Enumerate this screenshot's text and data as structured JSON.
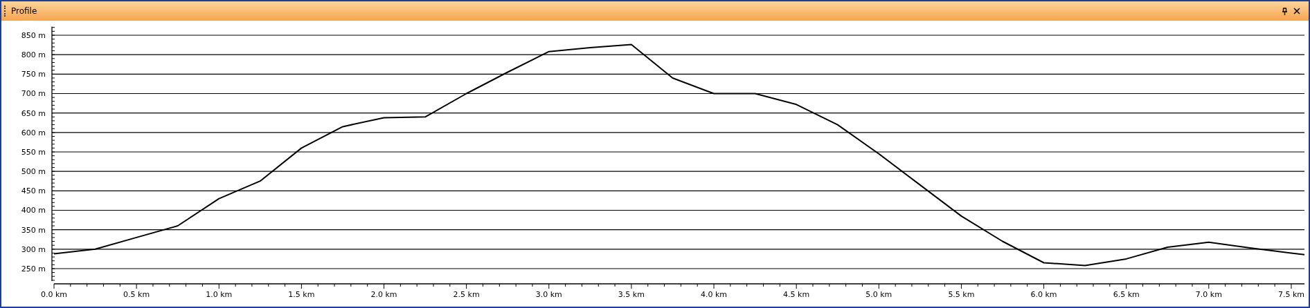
{
  "window": {
    "title": "Profile",
    "pinned": true,
    "closable": true
  },
  "chart_data": {
    "type": "line",
    "grid": true,
    "xlim": [
      0,
      7.58
    ],
    "ylim": [
      218,
      872
    ],
    "x": [
      0,
      0.25,
      0.5,
      0.75,
      1.0,
      1.25,
      1.5,
      1.75,
      2.0,
      2.25,
      2.5,
      2.75,
      3.0,
      3.25,
      3.5,
      3.75,
      4.0,
      4.25,
      4.5,
      4.75,
      5.0,
      5.25,
      5.5,
      5.75,
      6.0,
      6.25,
      6.5,
      6.75,
      7.0,
      7.25,
      7.5,
      7.58
    ],
    "series": [
      {
        "color": "#000000",
        "values": [
          288,
          300,
          330,
          360,
          430,
          475,
          560,
          615,
          638,
          640,
          700,
          755,
          808,
          818,
          826,
          740,
          700,
          700,
          672,
          620,
          545,
          465,
          385,
          320,
          265,
          258,
          275,
          305,
          318,
          303,
          290,
          286
        ]
      }
    ],
    "xticks": [
      {
        "value": 0,
        "label": "0.0 km"
      },
      {
        "value": 0.5,
        "label": "0.5 km"
      },
      {
        "value": 1,
        "label": "1.0 km"
      },
      {
        "value": 1.5,
        "label": "1.5 km"
      },
      {
        "value": 2,
        "label": "2.0 km"
      },
      {
        "value": 2.5,
        "label": "2.5 km"
      },
      {
        "value": 3,
        "label": "3.0 km"
      },
      {
        "value": 3.5,
        "label": "3.5 km"
      },
      {
        "value": 4,
        "label": "4.0 km"
      },
      {
        "value": 4.5,
        "label": "4.5 km"
      },
      {
        "value": 5,
        "label": "5.0 km"
      },
      {
        "value": 5.5,
        "label": "5.5 km"
      },
      {
        "value": 6,
        "label": "6.0 km"
      },
      {
        "value": 6.5,
        "label": "6.5 km"
      },
      {
        "value": 7,
        "label": "7.0 km"
      },
      {
        "value": 7.5,
        "label": "7.5 km"
      }
    ],
    "yticks": [
      {
        "value": 250,
        "label": "250 m"
      },
      {
        "value": 300,
        "label": "300 m"
      },
      {
        "value": 350,
        "label": "350 m"
      },
      {
        "value": 400,
        "label": "400 m"
      },
      {
        "value": 450,
        "label": "450 m"
      },
      {
        "value": 500,
        "label": "500 m"
      },
      {
        "value": 550,
        "label": "550 m"
      },
      {
        "value": 600,
        "label": "600 m"
      },
      {
        "value": 650,
        "label": "650 m"
      },
      {
        "value": 700,
        "label": "700 m"
      },
      {
        "value": 750,
        "label": "750 m"
      },
      {
        "value": 800,
        "label": "800 m"
      },
      {
        "value": 850,
        "label": "850 m"
      }
    ]
  }
}
